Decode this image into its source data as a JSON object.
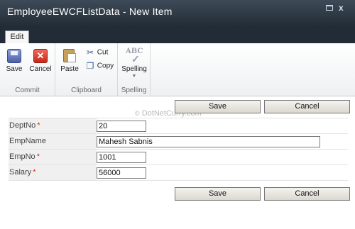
{
  "window": {
    "title": "EmployeeEWCFListData - New Item",
    "maximize_glyph": "",
    "close_glyph": "x"
  },
  "ribbon": {
    "tab": "Edit",
    "groups": {
      "commit": {
        "label": "Commit",
        "save": "Save",
        "cancel": "Cancel"
      },
      "clipboard": {
        "label": "Clipboard",
        "paste": "Paste",
        "cut": "Cut",
        "copy": "Copy"
      },
      "spelling": {
        "label": "Spelling",
        "spelling": "Spelling",
        "icon_text": "ABC",
        "arrow": "▼"
      }
    }
  },
  "watermark": {
    "copyright": "©",
    "text": " DotNetCurry.com"
  },
  "form": {
    "top_buttons": {
      "save": "Save",
      "cancel": "Cancel"
    },
    "bottom_buttons": {
      "save": "Save",
      "cancel": "Cancel"
    },
    "required_marker": "*",
    "fields": [
      {
        "label": "DeptNo",
        "value": "20",
        "required": true
      },
      {
        "label": "EmpName",
        "value": "Mahesh Sabnis",
        "required": false
      },
      {
        "label": "EmpNo",
        "value": "1001",
        "required": true
      },
      {
        "label": "Salary",
        "value": "56000",
        "required": true
      }
    ]
  },
  "icons": {
    "save": "save-icon",
    "cancel": "cancel-icon",
    "paste": "paste-icon",
    "cut": "scissors-icon",
    "copy": "copy-icon",
    "spelling": "spellcheck-icon",
    "cut_glyph": "✂",
    "copy_glyph": "❐",
    "cancel_glyph": "✕",
    "check_glyph": "✓"
  },
  "colors": {
    "title_bar": "#2c3743",
    "required": "#e0241b",
    "label_bg": "#f0f0f0"
  }
}
